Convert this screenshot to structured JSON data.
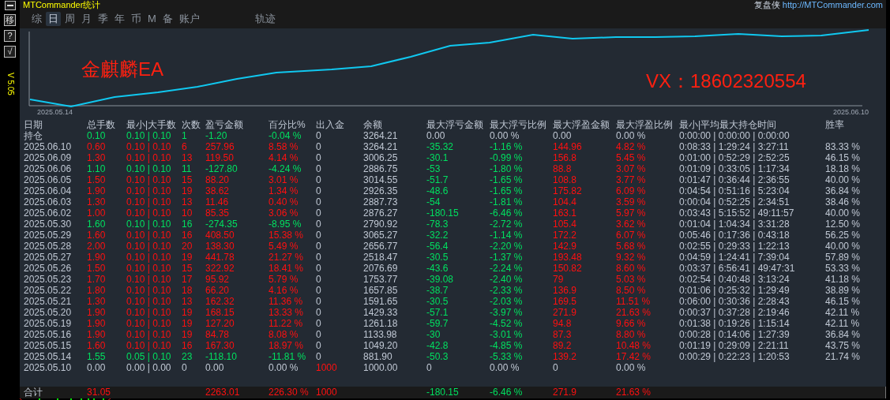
{
  "title": "MTCommander统计",
  "brand": {
    "name": "复盘侠",
    "url": "http://MTCommander.com"
  },
  "side_buttons": [
    {
      "kind": "minimize"
    },
    {
      "kind": "text",
      "label": "移"
    },
    {
      "kind": "text",
      "label": "?"
    },
    {
      "kind": "text",
      "label": "√"
    }
  ],
  "version": "V 5.05",
  "tabs": [
    {
      "label": "综",
      "selected": false
    },
    {
      "label": "日",
      "selected": true
    },
    {
      "label": "周",
      "selected": false
    },
    {
      "label": "月",
      "selected": false
    },
    {
      "label": "季",
      "selected": false
    },
    {
      "label": "年",
      "selected": false
    },
    {
      "label": "币",
      "selected": false
    },
    {
      "label": "M",
      "selected": false
    },
    {
      "label": "备",
      "selected": false
    },
    {
      "label": "账户",
      "selected": false
    }
  ],
  "track_tab": {
    "label": "轨迹",
    "selected": false
  },
  "chart": {
    "start_label": "2025.05.14",
    "end_label": "2025.06.10",
    "overlay_left": "金麒麟EA",
    "overlay_right": "VX：18602320554"
  },
  "columns": [
    "日期",
    "总手数",
    "最小|大手数",
    "次数",
    "盈亏金额",
    "百分比%",
    "出入金",
    "余额",
    "最大浮亏金额",
    "最大浮亏比例",
    "最大浮盈金额",
    "最大浮盈比例",
    "最小|平均最大持仓时间",
    "胜率"
  ],
  "rows": [
    {
      "kind": "open",
      "cells": [
        "持仓",
        "0.10",
        "0.10 | 0.10",
        "1",
        "-1.20",
        "-0.04 %",
        "0",
        "3264.21",
        "0.00",
        "0.00 %",
        "0.00",
        "0.00 %",
        "0:00:00 | 0:00:00 | 0:00:00"
      ]
    },
    {
      "kind": "profit",
      "cells": [
        "2025.06.10",
        "0.60",
        "0.10 | 0.10",
        "6",
        "257.96",
        "8.58 %",
        "0",
        "3264.21",
        "-35.32",
        "-1.16 %",
        "144.96",
        "4.82 %",
        "0:08:33 | 1:29:24 | 3:27:11",
        "83.33 %"
      ]
    },
    {
      "kind": "profit",
      "cells": [
        "2025.06.09",
        "1.30",
        "0.10 | 0.10",
        "13",
        "119.50",
        "4.14 %",
        "0",
        "3006.25",
        "-30.1",
        "-0.99 %",
        "156.8",
        "5.45 %",
        "0:01:00 | 0:52:29 | 2:52:25",
        "46.15 %"
      ]
    },
    {
      "kind": "loss",
      "cells": [
        "2025.06.06",
        "1.10",
        "0.10 | 0.10",
        "11",
        "-127.80",
        "-4.24 %",
        "0",
        "2886.75",
        "-53",
        "-1.80 %",
        "88.8",
        "3.07 %",
        "0:01:09 | 0:33:05 | 1:17:34",
        "18.18 %"
      ]
    },
    {
      "kind": "profit",
      "cells": [
        "2025.06.05",
        "1.50",
        "0.10 | 0.10",
        "15",
        "88.20",
        "3.01 %",
        "0",
        "3014.55",
        "-51.7",
        "-1.65 %",
        "108.8",
        "3.77 %",
        "0:01:47 | 0:36:44 | 2:36:55",
        "40.00 %"
      ]
    },
    {
      "kind": "profit",
      "cells": [
        "2025.06.04",
        "1.90",
        "0.10 | 0.10",
        "19",
        "38.62",
        "1.34 %",
        "0",
        "2926.35",
        "-48.6",
        "-1.65 %",
        "175.82",
        "6.09 %",
        "0:04:54 | 0:51:16 | 5:23:04",
        "36.84 %"
      ]
    },
    {
      "kind": "profit",
      "cells": [
        "2025.06.03",
        "1.30",
        "0.10 | 0.10",
        "13",
        "11.46",
        "0.40 %",
        "0",
        "2887.73",
        "-54",
        "-1.81 %",
        "104.4",
        "3.59 %",
        "0:00:04 | 0:52:25 | 2:34:51",
        "38.46 %"
      ]
    },
    {
      "kind": "profit",
      "cells": [
        "2025.06.02",
        "1.00",
        "0.10 | 0.10",
        "10",
        "85.35",
        "3.06 %",
        "0",
        "2876.27",
        "-180.15",
        "-6.46 %",
        "163.1",
        "5.97 %",
        "0:03:43 | 5:15:52 | 49:11:57",
        "40.00 %"
      ]
    },
    {
      "kind": "loss",
      "cells": [
        "2025.05.30",
        "1.60",
        "0.10 | 0.10",
        "16",
        "-274.35",
        "-8.95 %",
        "0",
        "2790.92",
        "-78.3",
        "-2.72 %",
        "105.4",
        "3.62 %",
        "0:01:04 | 1:04:34 | 3:31:28",
        "12.50 %"
      ]
    },
    {
      "kind": "profit",
      "cells": [
        "2025.05.29",
        "1.60",
        "0.10 | 0.10",
        "16",
        "408.50",
        "15.38 %",
        "0",
        "3065.27",
        "-32.2",
        "-1.14 %",
        "172.2",
        "6.07 %",
        "0:05:46 | 0:17:36 | 0:43:18",
        "56.25 %"
      ]
    },
    {
      "kind": "profit",
      "cells": [
        "2025.05.28",
        "2.00",
        "0.10 | 0.10",
        "20",
        "138.30",
        "5.49 %",
        "0",
        "2656.77",
        "-56.4",
        "-2.20 %",
        "142.9",
        "5.68 %",
        "0:02:55 | 0:29:33 | 1:22:13",
        "40.00 %"
      ]
    },
    {
      "kind": "profit",
      "cells": [
        "2025.05.27",
        "1.90",
        "0.10 | 0.10",
        "19",
        "441.78",
        "21.27 %",
        "0",
        "2518.47",
        "-30.5",
        "-1.37 %",
        "193.48",
        "9.32 %",
        "0:04:59 | 1:24:41 | 7:39:04",
        "57.89 %"
      ]
    },
    {
      "kind": "profit",
      "cells": [
        "2025.05.26",
        "1.50",
        "0.10 | 0.10",
        "15",
        "322.92",
        "18.41 %",
        "0",
        "2076.69",
        "-43.6",
        "-2.24 %",
        "150.82",
        "8.60 %",
        "0:03:37 | 6:56:41 | 49:47:31",
        "53.33 %"
      ]
    },
    {
      "kind": "profit",
      "cells": [
        "2025.05.23",
        "1.70",
        "0.10 | 0.10",
        "17",
        "95.92",
        "5.79 %",
        "0",
        "1753.77",
        "-39.08",
        "-2.40 %",
        "79",
        "5.03 %",
        "0:02:54 | 0:40:48 | 3:13:24",
        "41.18 %"
      ]
    },
    {
      "kind": "profit",
      "cells": [
        "2025.05.22",
        "1.80",
        "0.10 | 0.10",
        "18",
        "66.20",
        "4.16 %",
        "0",
        "1657.85",
        "-38.7",
        "-2.33 %",
        "136.9",
        "8.50 %",
        "0:01:06 | 0:25:32 | 1:29:49",
        "38.89 %"
      ]
    },
    {
      "kind": "profit",
      "cells": [
        "2025.05.21",
        "1.30",
        "0.10 | 0.10",
        "13",
        "162.32",
        "11.36 %",
        "0",
        "1591.65",
        "-30.5",
        "-2.03 %",
        "169.5",
        "11.51 %",
        "0:06:00 | 0:30:36 | 2:28:43",
        "46.15 %"
      ]
    },
    {
      "kind": "profit",
      "cells": [
        "2025.05.20",
        "1.90",
        "0.10 | 0.10",
        "19",
        "168.15",
        "13.33 %",
        "0",
        "1429.33",
        "-57.1",
        "-3.97 %",
        "271.9",
        "21.63 %",
        "0:00:37 | 0:37:28 | 2:19:46",
        "42.11 %"
      ]
    },
    {
      "kind": "profit",
      "cells": [
        "2025.05.19",
        "1.90",
        "0.10 | 0.10",
        "19",
        "127.20",
        "11.22 %",
        "0",
        "1261.18",
        "-59.7",
        "-4.52 %",
        "94.8",
        "9.66 %",
        "0:01:38 | 0:19:26 | 1:15:14",
        "42.11 %"
      ]
    },
    {
      "kind": "profit",
      "cells": [
        "2025.05.16",
        "1.90",
        "0.10 | 0.10",
        "19",
        "84.78",
        "8.08 %",
        "0",
        "1133.98",
        "-30",
        "-3.01 %",
        "87.3",
        "8.80 %",
        "0:00:28 | 0:14:06 | 1:27:39",
        "36.84 %"
      ]
    },
    {
      "kind": "profit",
      "cells": [
        "2025.05.15",
        "1.60",
        "0.10 | 0.10",
        "16",
        "167.30",
        "18.97 %",
        "0",
        "1049.20",
        "-42.8",
        "-4.85 %",
        "89.2",
        "10.48 %",
        "0:01:19 | 0:29:09 | 2:21:11",
        "43.75 %"
      ]
    },
    {
      "kind": "loss",
      "cells": [
        "2025.05.14",
        "1.55",
        "0.05 | 0.10",
        "23",
        "-118.10",
        "-11.81 %",
        "0",
        "881.90",
        "-50.3",
        "-5.33 %",
        "139.2",
        "17.42 %",
        "0:00:29 | 0:22:23 | 1:20:53",
        "21.74 %"
      ]
    },
    {
      "kind": "deposit",
      "cells": [
        "2025.05.10",
        "0.00",
        "0.00 | 0.00",
        "0",
        "0.00",
        "0.00 %",
        "1000",
        "1000.00",
        "0",
        "0.00 %",
        "0",
        "0.00 %"
      ]
    }
  ],
  "totals": {
    "label": "合计",
    "lots": "31.05",
    "profit": "2263.01",
    "percent": "226.30 %",
    "deposit": "1000",
    "max_float_loss": "-180.15",
    "max_float_loss_ratio": "-6.46 %",
    "max_float_profit": "271.9",
    "max_float_profit_ratio": "21.63 %"
  }
}
